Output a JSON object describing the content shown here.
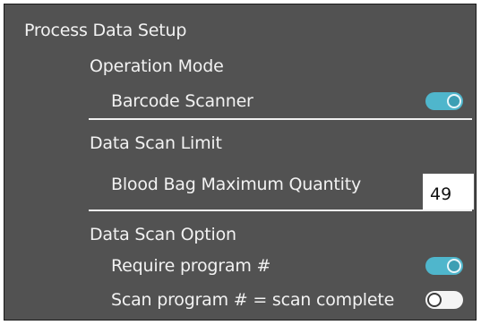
{
  "panel_title": "Process Data Setup",
  "sections": [
    {
      "heading": "Operation Mode",
      "rows": [
        {
          "label": "Barcode Scanner",
          "control": "toggle",
          "state": "on"
        }
      ]
    },
    {
      "heading": "Data Scan Limit",
      "rows": [
        {
          "label": "Blood Bag Maximum Quantity",
          "control": "number-input",
          "value": "49"
        }
      ]
    },
    {
      "heading": "Data Scan Option",
      "rows": [
        {
          "label": "Require program #",
          "control": "toggle",
          "state": "on"
        },
        {
          "label": "Scan program # = scan complete",
          "control": "toggle",
          "state": "off"
        }
      ]
    }
  ],
  "colors": {
    "panel_background": "#525252",
    "text": "#f2f2f2",
    "toggle_on": "#4fb6cc",
    "toggle_off": "#f4f4f4"
  }
}
